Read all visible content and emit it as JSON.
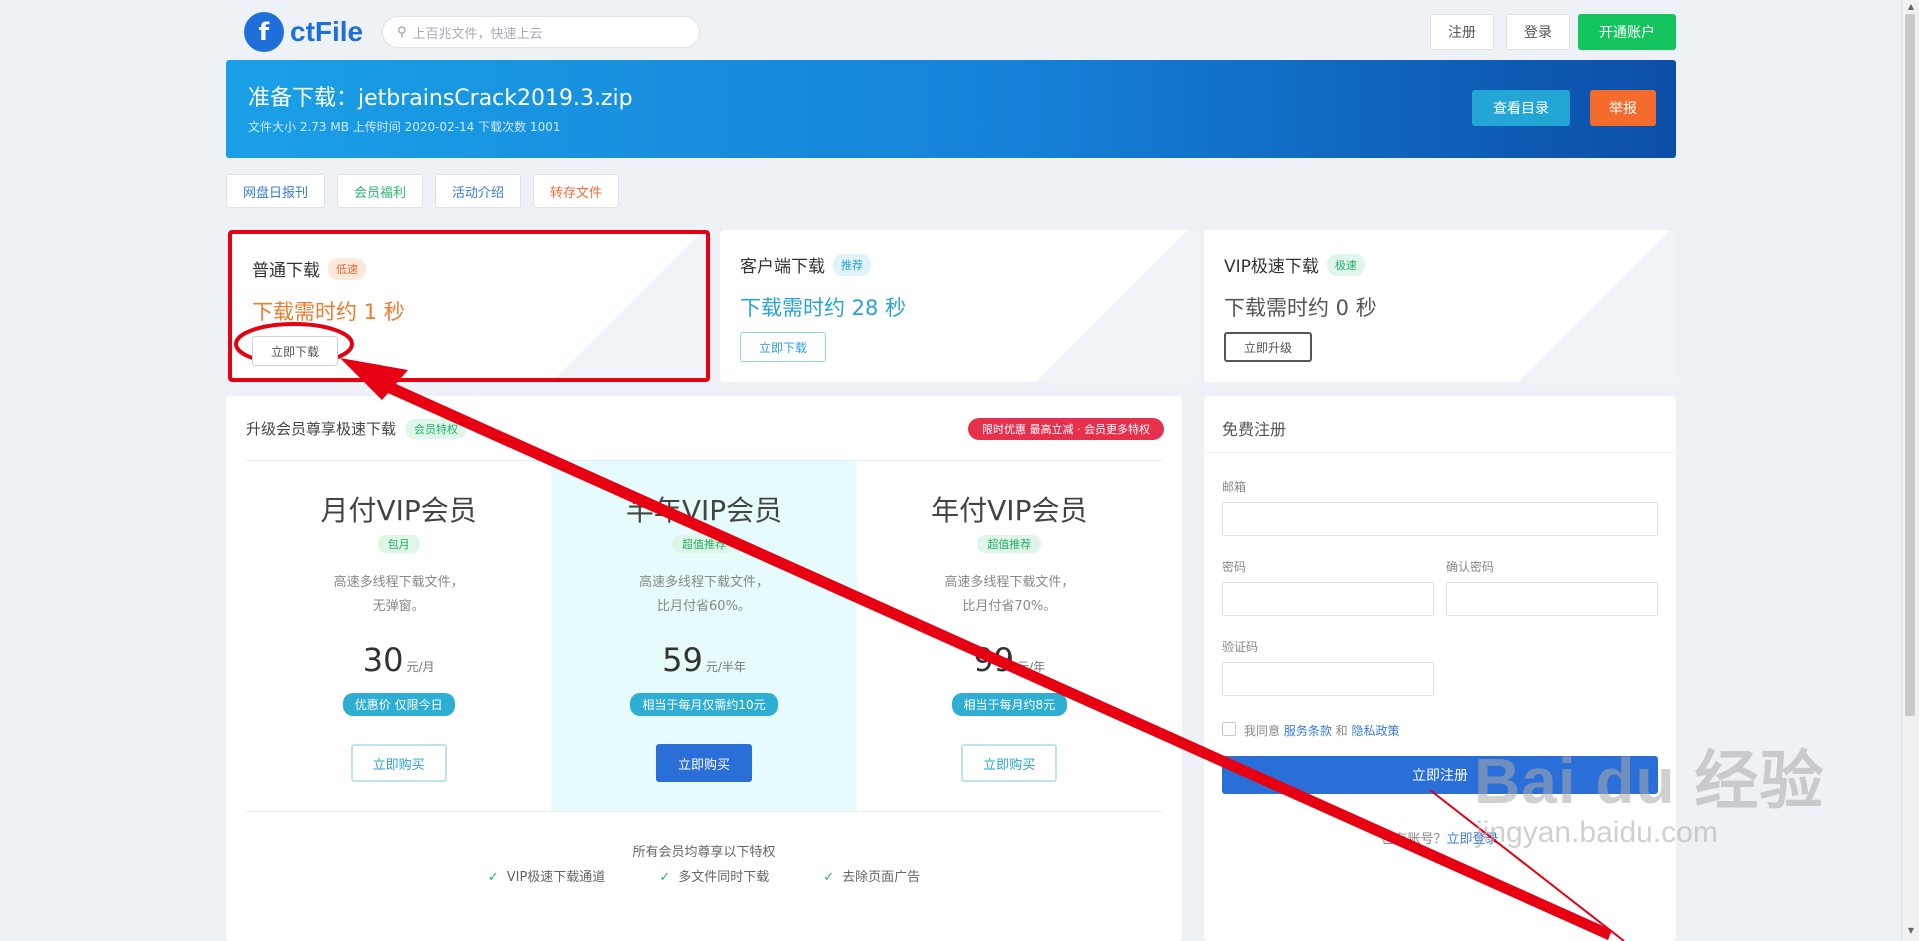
{
  "header": {
    "logo_mark": "f",
    "logo_text": "ctFile",
    "search_placeholder": "上百兆文件，快速上云",
    "register": "注册",
    "login": "登录",
    "open_account": "开通账户"
  },
  "banner": {
    "title": "准备下载：jetbrainsCrack2019.3.zip",
    "meta": "文件大小 2.73 MB   上传时间 2020-02-14   下载次数 1001",
    "dir_button": "查看目录",
    "report_button": "举报"
  },
  "tags": [
    "网盘日报刊",
    "会员福利",
    "活动介绍",
    "转存文件"
  ],
  "download_cards": [
    {
      "title": "普通下载",
      "badge": "低速",
      "eta": "下载需时约 1 秒",
      "button": "立即下载"
    },
    {
      "title": "客户端下载",
      "badge": "推荐",
      "eta": "下载需时约 28 秒",
      "button": "立即下载"
    },
    {
      "title": "VIP极速下载",
      "badge": "极速",
      "eta": "下载需时约 0 秒",
      "button": "立即升级"
    }
  ],
  "vip": {
    "heading": "升级会员尊享极速下载",
    "heading_tag": "会员特权",
    "promo": "限时优惠 最高立减 · 会员更多特权",
    "plans": [
      {
        "name": "月付VIP会员",
        "tag": "包月",
        "desc1": "高速多线程下载文件，",
        "desc2": "无弹窗。",
        "price": "30",
        "unit": "元/月",
        "badge": "优惠价 仅限今日",
        "button": "立即购买"
      },
      {
        "name": "半年VIP会员",
        "tag": "超值推荐",
        "desc1": "高速多线程下载文件，",
        "desc2": "比月付省60%。",
        "price": "59",
        "unit": "元/半年",
        "badge": "相当于每月仅需约10元",
        "button": "立即购买"
      },
      {
        "name": "年付VIP会员",
        "tag": "超值推荐",
        "desc1": "高速多线程下载文件，",
        "desc2": "比月付省70%。",
        "price": "99",
        "unit": "元/年",
        "badge": "相当于每月约8元",
        "button": "立即购买"
      }
    ],
    "perks_title": "所有会员均尊享以下特权",
    "perks": [
      "VIP极速下载通道",
      "多文件同时下载",
      "去除页面广告"
    ]
  },
  "register": {
    "title": "免费注册",
    "email_label": "邮箱",
    "password_label": "密码",
    "confirm_label": "确认密码",
    "code_label": "验证码",
    "agree_prefix": "我同意 ",
    "agree_terms": "服务条款",
    "agree_and": " 和 ",
    "agree_privacy": "隐私政策",
    "submit": "立即注册",
    "login_prompt": "已有账号？",
    "login_link": "立即登录"
  },
  "watermark": {
    "brand": "Bai du 经验",
    "url": "jingyan.baidu.com"
  },
  "colors": {
    "accent": "#2a6fd8",
    "annotation": "#e60012",
    "open_account": "#14c45f",
    "report": "#f46c2c"
  }
}
